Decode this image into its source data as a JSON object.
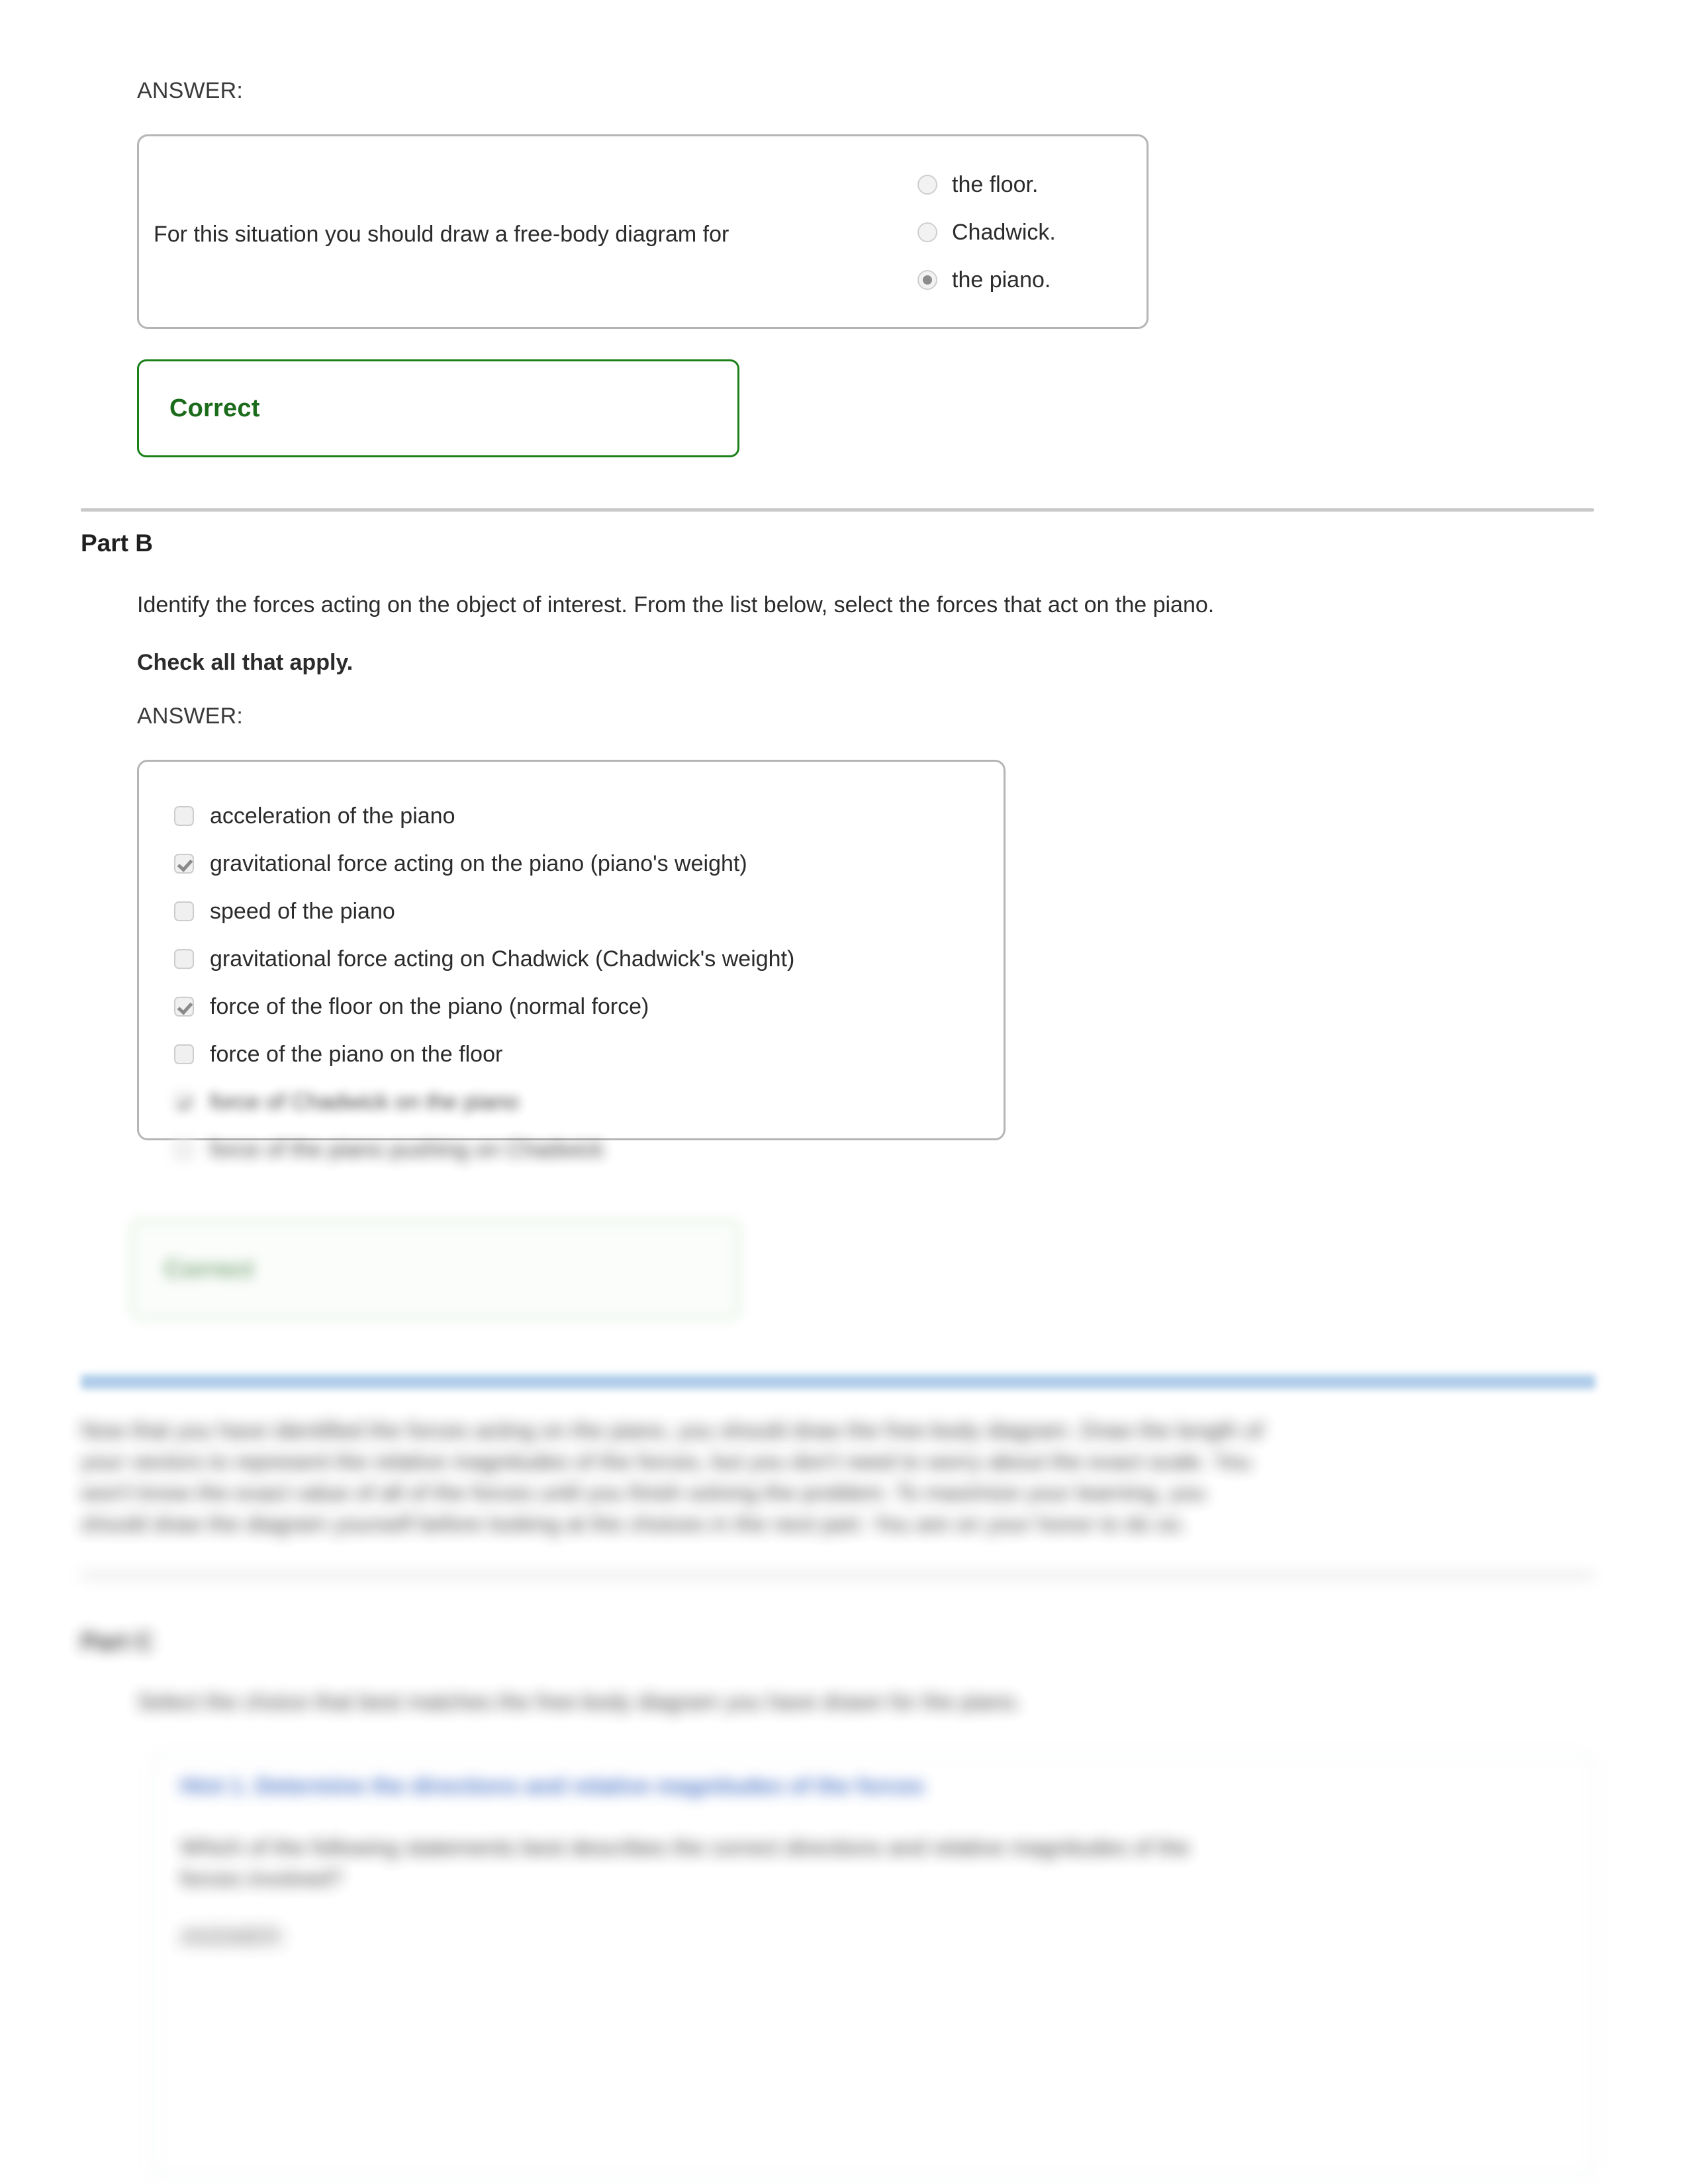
{
  "part_a": {
    "answer_label": "ANSWER:",
    "prompt": "For this situation you should draw a free-body diagram for",
    "options": [
      {
        "label": "the floor.",
        "selected": false
      },
      {
        "label": "Chadwick.",
        "selected": false
      },
      {
        "label": "the piano.",
        "selected": true
      }
    ],
    "feedback": "Correct"
  },
  "part_b": {
    "heading": "Part B",
    "instructions": "Identify the forces acting on the object of interest. From the list below, select the forces that act on the piano.",
    "check_all": "Check all that apply.",
    "answer_label": "ANSWER:",
    "options": [
      {
        "label": "acceleration of the piano",
        "checked": false
      },
      {
        "label": "gravitational force acting on the piano (piano's weight)",
        "checked": true
      },
      {
        "label": "speed of the piano",
        "checked": false
      },
      {
        "label": "gravitational force acting on Chadwick (Chadwick's weight)",
        "checked": false
      },
      {
        "label": "force of the floor on the piano (normal force)",
        "checked": true
      },
      {
        "label": "force of the piano on the floor",
        "checked": false
      },
      {
        "label": "force of Chadwick on the piano",
        "checked": true
      },
      {
        "label": "force of the piano pushing on Chadwick",
        "checked": false
      }
    ],
    "feedback": "Correct"
  },
  "explanation": {
    "line1": "Now that you have identified the forces acting on the piano, you should draw the free-body diagram. Draw the length of",
    "line2": "your vectors to represent the relative magnitudes of the forces, but you don't need to worry about the exact scale. You",
    "line3": "won't know the exact value of all of the forces until you finish solving the problem. To maximize your learning, you",
    "line4": "should draw the diagram yourself before looking at the choices in the next part. You are on your honor to do so."
  },
  "part_c": {
    "heading": "Part C",
    "instructions": "Select the choice that best matches the free-body diagram you have drawn for the piano.",
    "hint_number": "Hint 1.",
    "hint_title": "Determine the directions and relative magnitudes of the forces",
    "hint_body_line1": "Which of the following statements best describes the correct directions and relative magnitudes of the",
    "hint_body_line2": "forces involved?",
    "hint_answer_label": "ANSWER:"
  }
}
